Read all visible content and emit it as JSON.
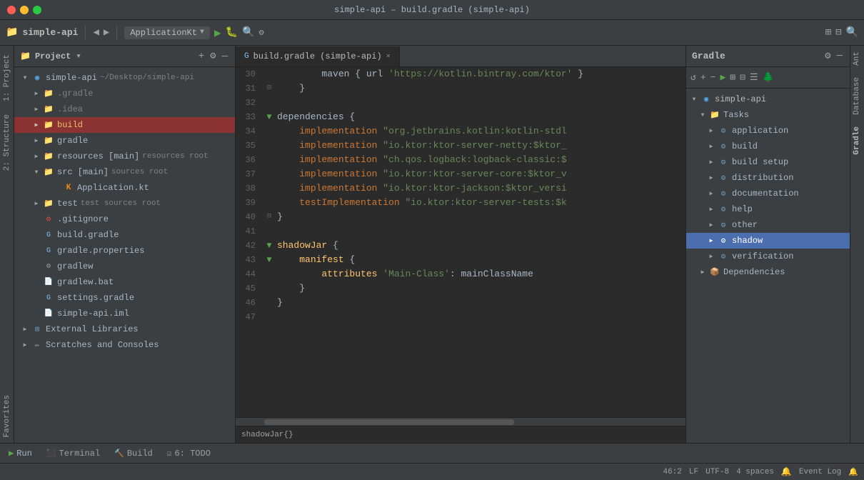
{
  "titleBar": {
    "title": "simple-api – build.gradle (simple-api)"
  },
  "toolbar": {
    "projectName": "simple-api",
    "runConfig": "ApplicationKt"
  },
  "projectPanel": {
    "title": "Project",
    "items": [
      {
        "id": "root",
        "label": "simple-api",
        "suffix": "~/Desktop/simple-api",
        "indent": 1,
        "type": "module",
        "expanded": true
      },
      {
        "id": "gradle-dir",
        "label": ".gradle",
        "indent": 2,
        "type": "folder",
        "expanded": false
      },
      {
        "id": "idea-dir",
        "label": ".idea",
        "indent": 2,
        "type": "folder",
        "expanded": false
      },
      {
        "id": "build-dir",
        "label": "build",
        "indent": 2,
        "type": "folder-highlight",
        "expanded": false
      },
      {
        "id": "gradle2-dir",
        "label": "gradle",
        "indent": 2,
        "type": "folder",
        "expanded": false
      },
      {
        "id": "resources-dir",
        "label": "resources [main]",
        "suffix": "resources root",
        "indent": 2,
        "type": "folder",
        "expanded": false
      },
      {
        "id": "src-dir",
        "label": "src [main]",
        "suffix": "sources root",
        "indent": 2,
        "type": "folder-src",
        "expanded": true
      },
      {
        "id": "appkt",
        "label": "Application.kt",
        "indent": 3,
        "type": "kotlin"
      },
      {
        "id": "test-dir",
        "label": "test",
        "suffix": "test sources root",
        "indent": 2,
        "type": "folder-test",
        "expanded": false
      },
      {
        "id": "gitignore",
        "label": ".gitignore",
        "indent": 2,
        "type": "file-git"
      },
      {
        "id": "build-gradle",
        "label": "build.gradle",
        "indent": 2,
        "type": "file-gradle"
      },
      {
        "id": "gradle-props",
        "label": "gradle.properties",
        "indent": 2,
        "type": "file-gradle"
      },
      {
        "id": "gradlew",
        "label": "gradlew",
        "indent": 2,
        "type": "file-exec"
      },
      {
        "id": "gradlew-bat",
        "label": "gradlew.bat",
        "indent": 2,
        "type": "file-bat"
      },
      {
        "id": "settings-gradle",
        "label": "settings.gradle",
        "indent": 2,
        "type": "file-gradle"
      },
      {
        "id": "simple-api-iml",
        "label": "simple-api.iml",
        "indent": 2,
        "type": "file-iml"
      },
      {
        "id": "ext-libs",
        "label": "External Libraries",
        "indent": 1,
        "type": "ext-libs",
        "expanded": false
      },
      {
        "id": "scratches",
        "label": "Scratches and Consoles",
        "indent": 1,
        "type": "scratches",
        "expanded": false
      }
    ]
  },
  "editor": {
    "tabs": [
      {
        "id": "build-gradle",
        "label": "build.gradle (simple-api)",
        "active": true
      }
    ],
    "lines": [
      {
        "num": 30,
        "hasFold": false,
        "content": "        maven { url 'https://kotlin.bintray.com/ktor' }",
        "parts": [
          {
            "text": "        maven { url ",
            "cls": "var"
          },
          {
            "text": "'https://kotlin.bintray.com/ktor'",
            "cls": "str"
          },
          {
            "text": " }",
            "cls": "var"
          }
        ]
      },
      {
        "num": 31,
        "hasFold": true,
        "foldOpen": false,
        "content": "    }",
        "parts": [
          {
            "text": "    }",
            "cls": "var"
          }
        ]
      },
      {
        "num": 32,
        "hasFold": false,
        "content": "",
        "parts": []
      },
      {
        "num": 33,
        "hasFold": true,
        "foldOpen": true,
        "content": "dependencies {",
        "parts": [
          {
            "text": "dependencies ",
            "cls": "var"
          },
          {
            "text": "{",
            "cls": "var"
          }
        ]
      },
      {
        "num": 34,
        "hasFold": false,
        "content": "    implementation \"org.jetbrains.kotlin:kotlin-stdl",
        "parts": [
          {
            "text": "    "
          },
          {
            "text": "implementation ",
            "cls": "kw"
          },
          {
            "text": "\"org.jetbrains.kotlin:kotlin-stdl",
            "cls": "str"
          }
        ]
      },
      {
        "num": 35,
        "hasFold": false,
        "content": "    implementation \"io.ktor:ktor-server-netty:$ktor_",
        "parts": [
          {
            "text": "    "
          },
          {
            "text": "implementation ",
            "cls": "kw"
          },
          {
            "text": "\"io.ktor:ktor-server-netty:$ktor_",
            "cls": "str"
          }
        ]
      },
      {
        "num": 36,
        "hasFold": false,
        "content": "    implementation \"ch.qos.logback:logback-classic:$",
        "parts": [
          {
            "text": "    "
          },
          {
            "text": "implementation ",
            "cls": "kw"
          },
          {
            "text": "\"ch.qos.logback:logback-classic:$",
            "cls": "str"
          }
        ]
      },
      {
        "num": 37,
        "hasFold": false,
        "content": "    implementation \"io.ktor:ktor-server-core:$ktor_v",
        "parts": [
          {
            "text": "    "
          },
          {
            "text": "implementation ",
            "cls": "kw"
          },
          {
            "text": "\"io.ktor:ktor-server-core:$ktor_v",
            "cls": "str"
          }
        ]
      },
      {
        "num": 38,
        "hasFold": false,
        "content": "    implementation \"io.ktor:ktor-jackson:$ktor_versi",
        "parts": [
          {
            "text": "    "
          },
          {
            "text": "implementation ",
            "cls": "kw"
          },
          {
            "text": "\"io.ktor:ktor-jackson:$ktor_versi",
            "cls": "str"
          }
        ]
      },
      {
        "num": 39,
        "hasFold": false,
        "content": "    testImplementation \"io.ktor:ktor-server-tests:$k",
        "parts": [
          {
            "text": "    "
          },
          {
            "text": "testImplementation ",
            "cls": "kw"
          },
          {
            "text": "\"io.ktor:ktor-server-tests:$k",
            "cls": "str"
          }
        ]
      },
      {
        "num": 40,
        "hasFold": true,
        "foldOpen": false,
        "content": "}",
        "parts": [
          {
            "text": "}",
            "cls": "var"
          }
        ]
      },
      {
        "num": 41,
        "hasFold": false,
        "content": "",
        "parts": []
      },
      {
        "num": 42,
        "hasFold": true,
        "foldOpen": true,
        "content": "shadowJar {",
        "parts": [
          {
            "text": "shadowJar",
            "cls": "fn"
          },
          {
            "text": " {",
            "cls": "var"
          }
        ]
      },
      {
        "num": 43,
        "hasFold": true,
        "foldOpen": true,
        "content": "    manifest {",
        "parts": [
          {
            "text": "    manifest",
            "cls": "fn"
          },
          {
            "text": " {",
            "cls": "var"
          }
        ]
      },
      {
        "num": 44,
        "hasFold": false,
        "content": "        attributes 'Main-Class': mainClassName",
        "parts": [
          {
            "text": "        "
          },
          {
            "text": "attributes ",
            "cls": "fn"
          },
          {
            "text": "'Main-Class'",
            "cls": "str"
          },
          {
            "text": ": ",
            "cls": "var"
          },
          {
            "text": "mainClassName",
            "cls": "var"
          }
        ]
      },
      {
        "num": 45,
        "hasFold": false,
        "content": "    }",
        "parts": [
          {
            "text": "    }",
            "cls": "var"
          }
        ]
      },
      {
        "num": 46,
        "hasFold": false,
        "content": "}",
        "parts": [
          {
            "text": "}",
            "cls": "var"
          }
        ]
      },
      {
        "num": 47,
        "hasFold": false,
        "content": "",
        "parts": []
      }
    ]
  },
  "gradle": {
    "title": "Gradle",
    "tree": [
      {
        "id": "simple-api-root",
        "label": "simple-api",
        "indent": 0,
        "expanded": true,
        "type": "module"
      },
      {
        "id": "tasks",
        "label": "Tasks",
        "indent": 1,
        "expanded": true,
        "type": "folder"
      },
      {
        "id": "application",
        "label": "application",
        "indent": 2,
        "expanded": false,
        "type": "task-folder"
      },
      {
        "id": "build",
        "label": "build",
        "indent": 2,
        "expanded": false,
        "type": "task-folder"
      },
      {
        "id": "build-setup",
        "label": "build setup",
        "indent": 2,
        "expanded": false,
        "type": "task-folder"
      },
      {
        "id": "distribution",
        "label": "distribution",
        "indent": 2,
        "expanded": false,
        "type": "task-folder"
      },
      {
        "id": "documentation",
        "label": "documentation",
        "indent": 2,
        "expanded": false,
        "type": "task-folder"
      },
      {
        "id": "help",
        "label": "help",
        "indent": 2,
        "expanded": false,
        "type": "task-folder"
      },
      {
        "id": "other",
        "label": "other",
        "indent": 2,
        "expanded": false,
        "type": "task-folder"
      },
      {
        "id": "shadow",
        "label": "shadow",
        "indent": 2,
        "expanded": false,
        "type": "task-folder",
        "selected": true
      },
      {
        "id": "verification",
        "label": "verification",
        "indent": 2,
        "expanded": false,
        "type": "task-folder"
      },
      {
        "id": "dependencies",
        "label": "Dependencies",
        "indent": 1,
        "expanded": false,
        "type": "deps-folder"
      }
    ]
  },
  "statusBar": {
    "position": "46:2",
    "lineEnding": "LF",
    "encoding": "UTF-8",
    "indent": "4 spaces"
  },
  "bottomTabs": [
    {
      "id": "run",
      "label": "Run",
      "icon": "▶"
    },
    {
      "id": "terminal",
      "label": "Terminal",
      "icon": "⬛"
    },
    {
      "id": "build",
      "label": "Build",
      "icon": "🔨"
    },
    {
      "id": "todo",
      "label": "6: TODO",
      "icon": "☑"
    }
  ],
  "breadcrumb": {
    "text": "shadowJar{}"
  },
  "structureTabs": [
    "1: Project",
    "2: Structure",
    "Favorites"
  ]
}
